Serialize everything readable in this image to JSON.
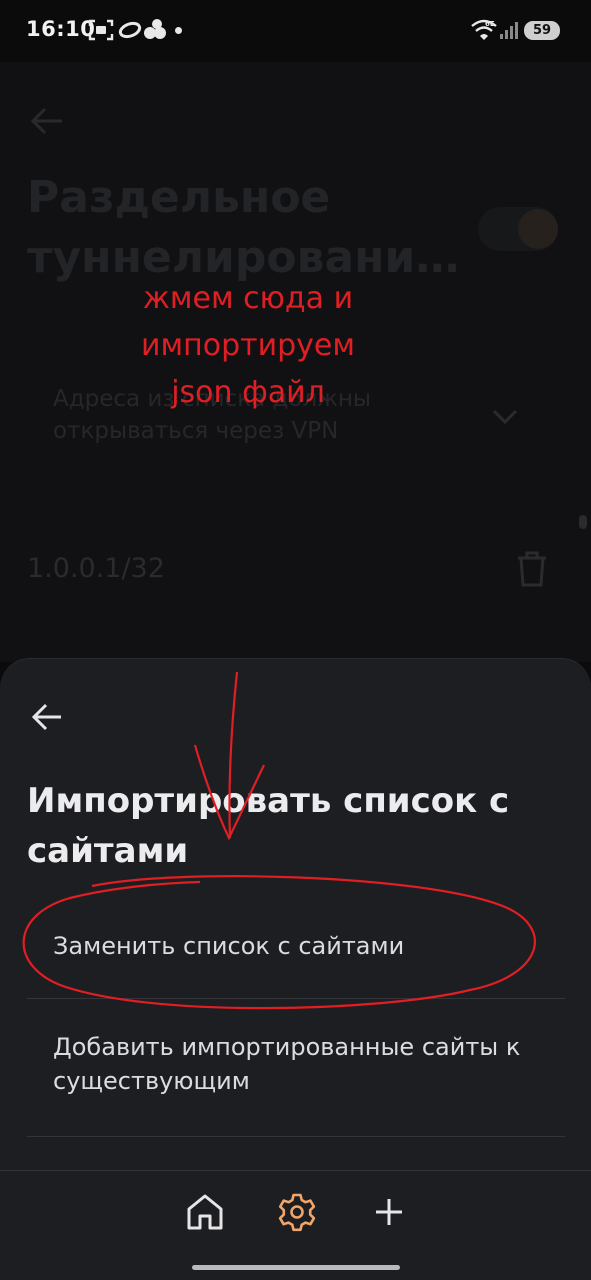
{
  "status_bar": {
    "time": "16:10",
    "battery": "59",
    "network": "6E"
  },
  "background_screen": {
    "title": "Раздельное\nтуннелировани…",
    "dropdown_text": "Адреса из списка должны открываться через VPN",
    "ip_entry": "1.0.0.1/32"
  },
  "sheet": {
    "title": "Импортировать список с сайтами",
    "options": [
      {
        "label": "Заменить список с сайтами"
      },
      {
        "label": "Добавить импортированные сайты к существующим"
      }
    ]
  },
  "nav": {
    "items": [
      {
        "icon": "home-icon"
      },
      {
        "icon": "gear-icon"
      },
      {
        "icon": "plus-icon"
      }
    ],
    "active_color": "#f0a56a"
  },
  "annotation": {
    "text": "жмем сюда и\nимпортируем\njson файл",
    "color": "#e01f24"
  }
}
